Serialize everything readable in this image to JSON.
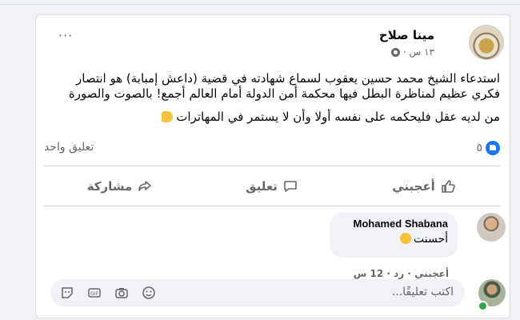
{
  "post": {
    "author": "مينا صلاح",
    "time": "١٣ س ·",
    "text_line1": "استدعاء الشيخ محمد حسين يعقوب لسماع شهادته في قضية (داعش إمبابة) هو انتصار فكري عظيم لمناظرة البطل فيها محكمة أمن الدولة أمام العالم أجمع! بالصوت والصورة",
    "text_line2": "من لديه عقل فليحكمه على نفسه أولا وأن لا يستمر في المهاترات",
    "like_count": "٥",
    "comment_count": "تعليق واحد"
  },
  "actions": {
    "like": "أعجبني",
    "comment": "تعليق",
    "share": "مشاركة"
  },
  "comment": {
    "author": "Mohamed Shabana",
    "text": "أحسنت",
    "meta": "أعجبني · رد · 12 س"
  },
  "input": {
    "placeholder": "اكتب تعليقًا..."
  },
  "icons": {
    "globe": "globe-icon",
    "more": "more-icon",
    "like": "thumbs-up-icon",
    "comment": "comment-icon",
    "share": "share-icon",
    "sticker": "sticker-icon",
    "gif": "gif-icon",
    "camera": "camera-icon",
    "emoji": "emoji-icon"
  },
  "colors": {
    "accent": "#1877f2",
    "muted": "#65676b",
    "online": "#31a24c"
  }
}
